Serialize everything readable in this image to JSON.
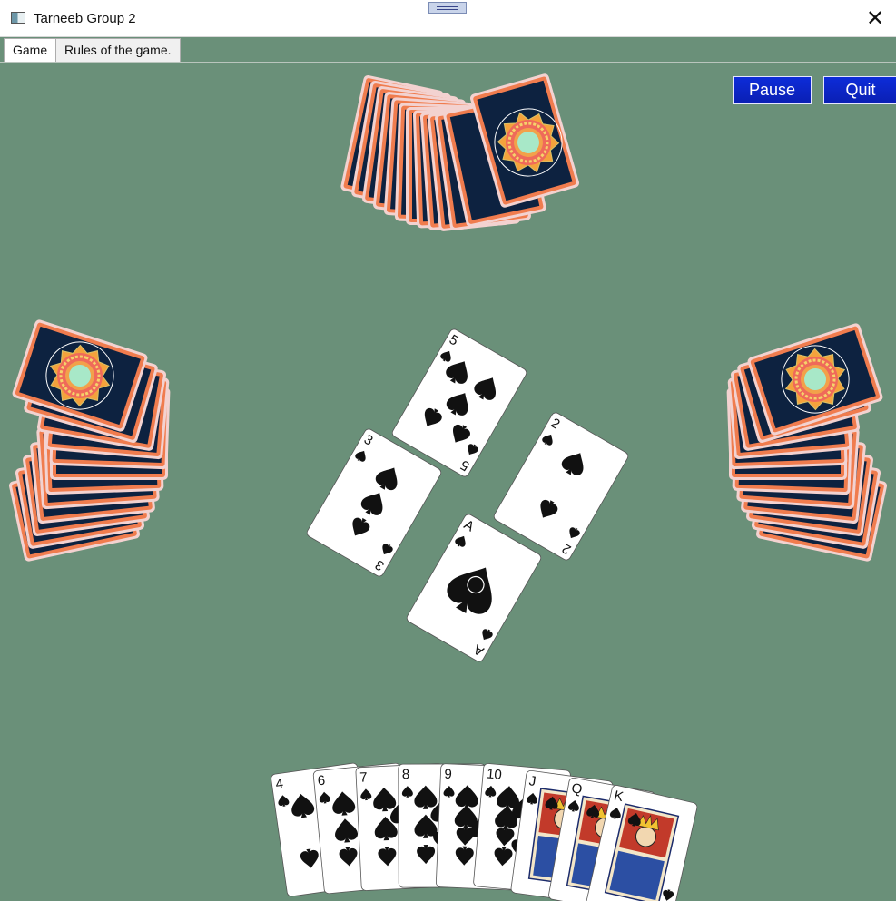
{
  "window": {
    "title": "Tarneeb Group 2"
  },
  "tabs": [
    {
      "label": "Game",
      "active": true
    },
    {
      "label": "Rules of the game.",
      "active": false
    }
  ],
  "controls": {
    "pause_label": "Pause",
    "quit_label": "Quit"
  },
  "colors": {
    "table_felt": "#6a9079",
    "card_back": "#0d2240",
    "card_border": "#f07c4e",
    "button_blue": "#0a22c4"
  },
  "trick": [
    {
      "seat": "north",
      "rank": "5",
      "suit": "spades"
    },
    {
      "seat": "west",
      "rank": "3",
      "suit": "spades"
    },
    {
      "seat": "east",
      "rank": "2",
      "suit": "spades"
    },
    {
      "seat": "south",
      "rank": "A",
      "suit": "spades"
    }
  ],
  "player_hand": [
    {
      "rank": "4",
      "suit": "spades"
    },
    {
      "rank": "6",
      "suit": "spades"
    },
    {
      "rank": "7",
      "suit": "spades"
    },
    {
      "rank": "8",
      "suit": "spades"
    },
    {
      "rank": "9",
      "suit": "spades"
    },
    {
      "rank": "10",
      "suit": "spades"
    },
    {
      "rank": "J",
      "suit": "spades"
    },
    {
      "rank": "Q",
      "suit": "spades"
    },
    {
      "rank": "K",
      "suit": "spades"
    }
  ],
  "opponents": {
    "north_card_count": 13,
    "west_card_count": 13,
    "east_card_count": 13
  }
}
